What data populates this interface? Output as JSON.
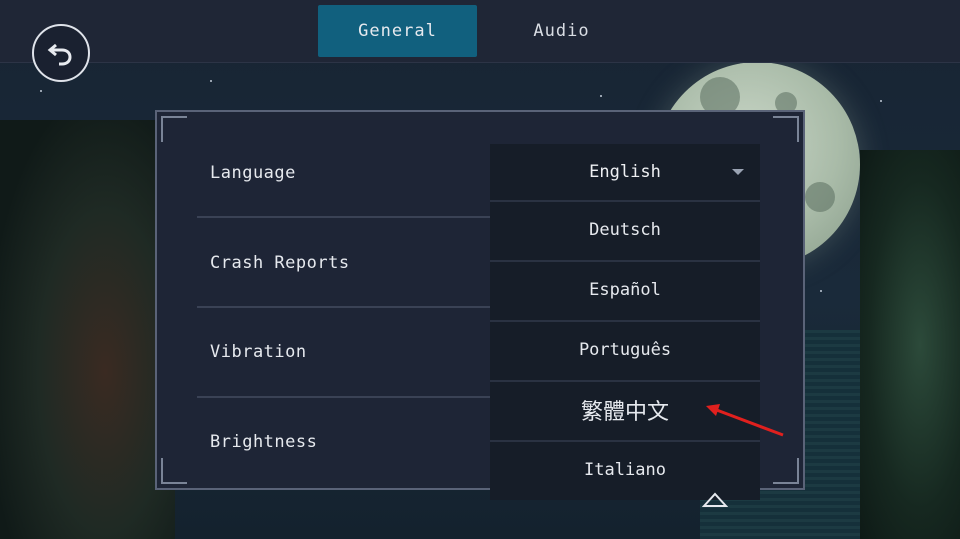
{
  "tabs": [
    {
      "label": "General",
      "active": true
    },
    {
      "label": "Audio",
      "active": false
    }
  ],
  "settings": {
    "rows": [
      {
        "label": "Language"
      },
      {
        "label": "Crash Reports"
      },
      {
        "label": "Vibration"
      },
      {
        "label": "Brightness"
      }
    ]
  },
  "language_dropdown": {
    "selected": "English",
    "options": [
      "Deutsch",
      "Español",
      "Português",
      "繁體中文",
      "Italiano"
    ]
  },
  "colors": {
    "accent_tab": "#11607e",
    "panel_bg": "#1e2536",
    "dropdown_bg": "#161d28",
    "annotation_arrow": "#e0201e"
  },
  "icons": {
    "back": "undo-arrow-icon",
    "dropdown": "caret-down-icon",
    "scroll": "chevron-up-icon"
  }
}
